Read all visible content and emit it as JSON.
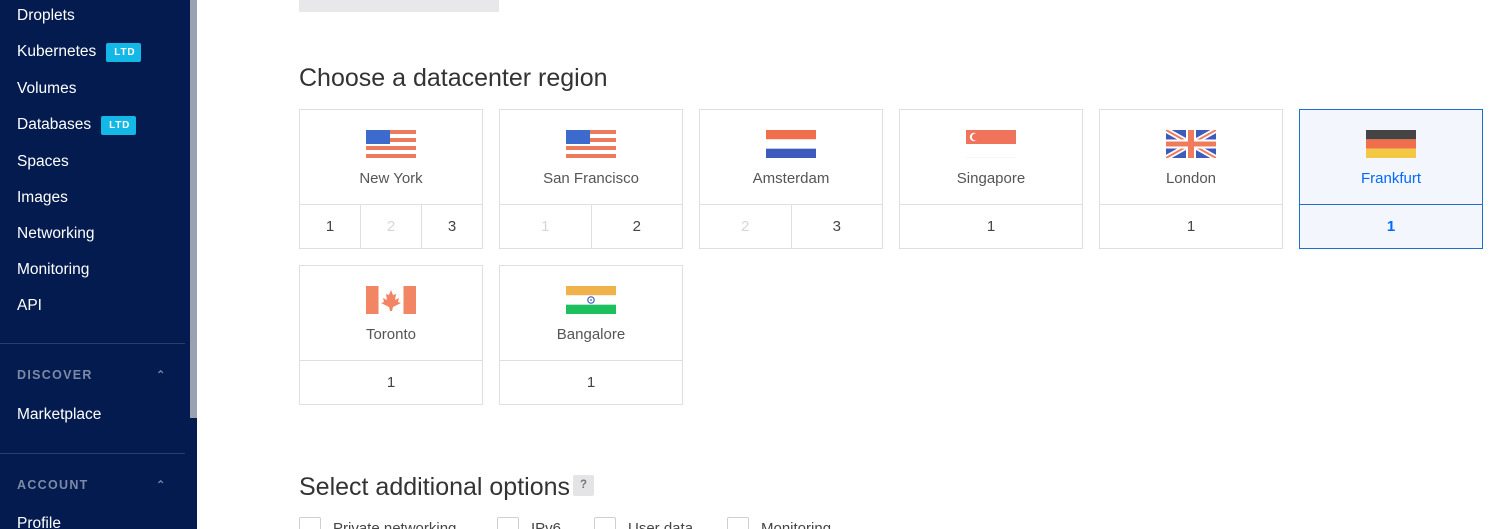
{
  "sidebar": {
    "items": [
      {
        "label": "Droplets"
      },
      {
        "label": "Kubernetes",
        "badge": "LTD"
      },
      {
        "label": "Volumes"
      },
      {
        "label": "Databases",
        "badge": "LTD"
      },
      {
        "label": "Spaces"
      },
      {
        "label": "Images"
      },
      {
        "label": "Networking"
      },
      {
        "label": "Monitoring"
      },
      {
        "label": "API"
      }
    ],
    "discover": {
      "heading": "DISCOVER",
      "items": [
        {
          "label": "Marketplace"
        }
      ]
    },
    "account": {
      "heading": "ACCOUNT",
      "items": [
        {
          "label": "Profile"
        }
      ]
    }
  },
  "main": {
    "region_heading": "Choose a datacenter region",
    "regions": [
      {
        "name": "New York",
        "flag": "us-flag-icon",
        "numbers": [
          "1",
          "2",
          "3"
        ],
        "disabled": [
          false,
          true,
          false
        ]
      },
      {
        "name": "San Francisco",
        "flag": "us-flag-icon",
        "numbers": [
          "1",
          "2"
        ],
        "disabled": [
          true,
          false
        ]
      },
      {
        "name": "Amsterdam",
        "flag": "netherlands-flag-icon",
        "numbers": [
          "2",
          "3"
        ],
        "disabled": [
          true,
          false
        ]
      },
      {
        "name": "Singapore",
        "flag": "singapore-flag-icon",
        "numbers": [
          "1"
        ],
        "disabled": [
          false
        ]
      },
      {
        "name": "London",
        "flag": "uk-flag-icon",
        "numbers": [
          "1"
        ],
        "disabled": [
          false
        ]
      },
      {
        "name": "Frankfurt",
        "flag": "germany-flag-icon",
        "numbers": [
          "1"
        ],
        "disabled": [
          false
        ],
        "selected": true
      },
      {
        "name": "Toronto",
        "flag": "canada-flag-icon",
        "numbers": [
          "1"
        ],
        "disabled": [
          false
        ]
      },
      {
        "name": "Bangalore",
        "flag": "india-flag-icon",
        "numbers": [
          "1"
        ],
        "disabled": [
          false
        ]
      }
    ],
    "options_heading": "Select additional options",
    "help_label": "?",
    "options": [
      {
        "label": "Private networking"
      },
      {
        "label": "IPv6"
      },
      {
        "label": "User data"
      },
      {
        "label": "Monitoring"
      }
    ]
  },
  "colors": {
    "sidebar_bg": "#031b4e",
    "badge": "#14b8e6",
    "accent": "#0069ff"
  }
}
